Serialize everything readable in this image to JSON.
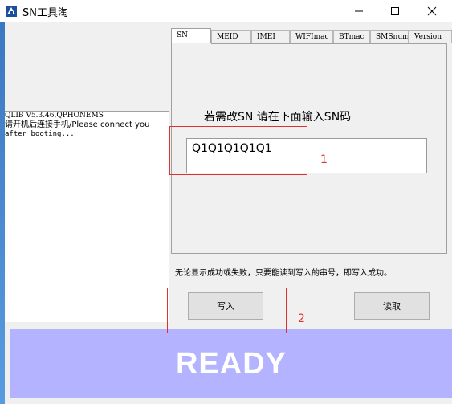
{
  "window": {
    "title": "SN工具淘",
    "controls": {
      "minimize": "minimize-icon",
      "maximize": "maximize-icon",
      "close": "close-icon"
    }
  },
  "log": {
    "lines": [
      "QLIB V5.3.46,QPHONEMS",
      "请开机后连接手机/Please connect you",
      "after booting..."
    ]
  },
  "tabs": [
    {
      "label": "SN",
      "active": true
    },
    {
      "label": "MEID",
      "active": false
    },
    {
      "label": "IMEI",
      "active": false
    },
    {
      "label": "WIFImac",
      "active": false
    },
    {
      "label": "BTmac",
      "active": false
    },
    {
      "label": "SMSnum",
      "active": false
    },
    {
      "label": "Version",
      "active": false
    }
  ],
  "sn_panel": {
    "prompt": "若需改SN 请在下面输入SN码",
    "sn_value": "Q1Q1Q1Q1Q1",
    "note": "无论显示成功或失败，只要能读到写入的串号，即写入成功。"
  },
  "buttons": {
    "write": "写入",
    "read": "读取"
  },
  "status": {
    "text": "READY",
    "color": "#b3b3ff"
  },
  "annotations": {
    "label1": "1",
    "label2": "2",
    "color": "#e03030"
  }
}
